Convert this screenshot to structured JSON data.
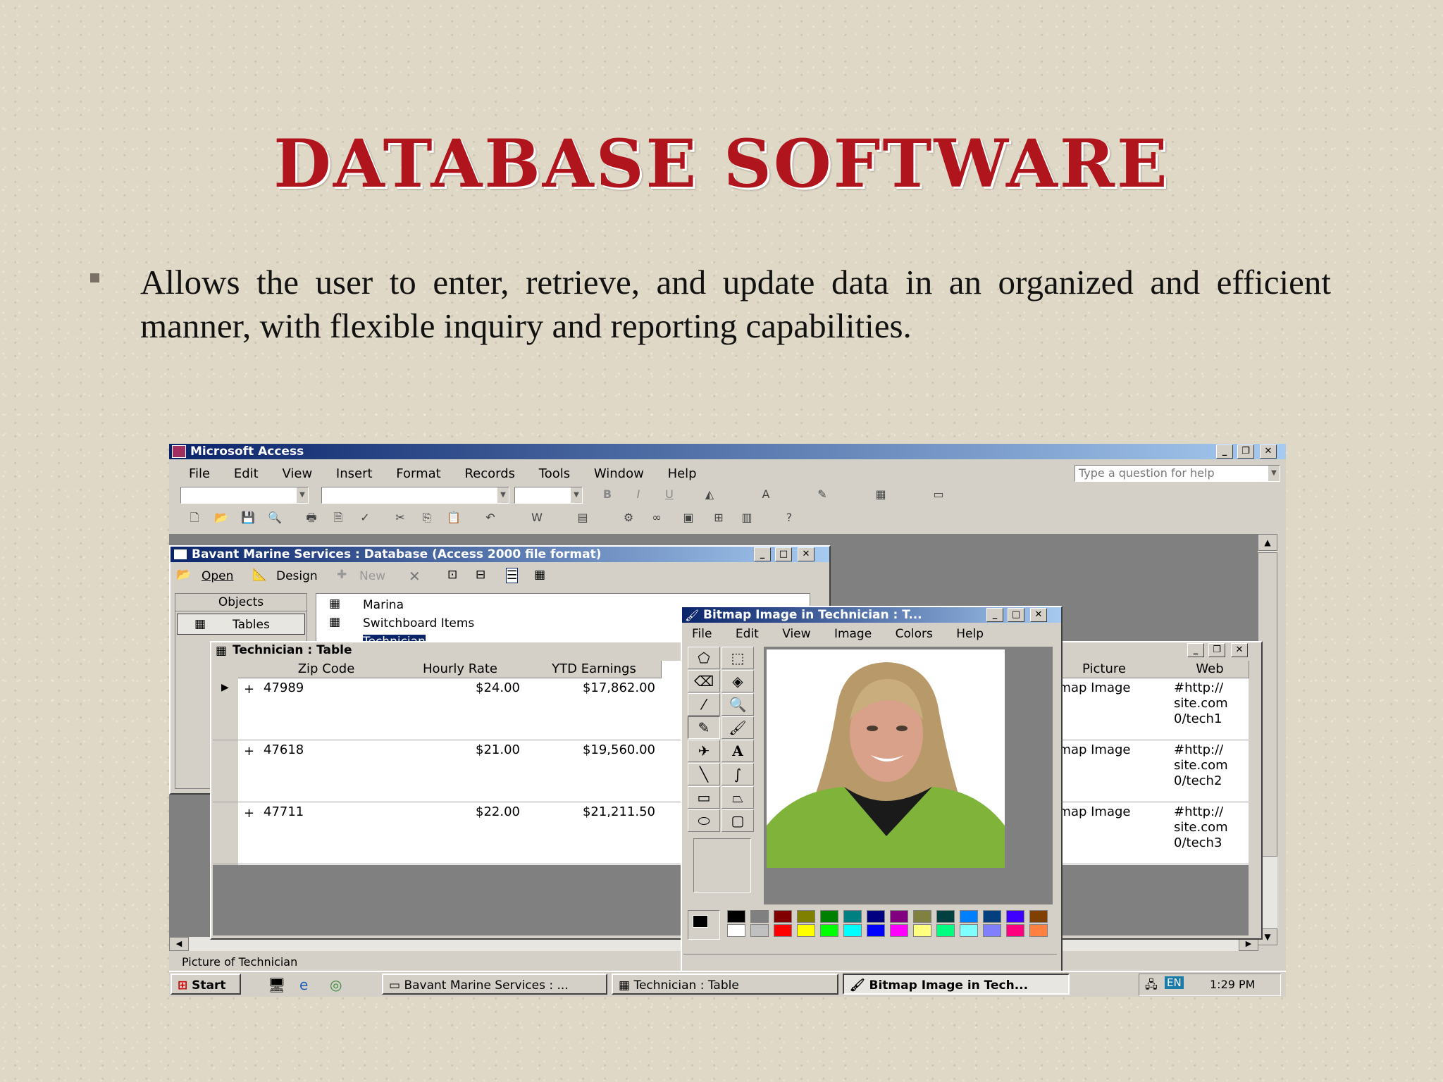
{
  "slide": {
    "title": "Database Software",
    "bullet": "Allows the user to enter, retrieve, and update data in an organized and efficient manner, with flexible inquiry and reporting capabilities."
  },
  "access": {
    "title": "Microsoft Access",
    "menu": [
      "File",
      "Edit",
      "View",
      "Insert",
      "Format",
      "Records",
      "Tools",
      "Window",
      "Help"
    ],
    "help_placeholder": "Type a question for help"
  },
  "db_window": {
    "title": "Bavant Marine Services : Database (Access 2000 file format)",
    "toolbar": {
      "open": "Open",
      "design": "Design",
      "new": "New"
    },
    "objects_label": "Objects",
    "tables_label": "Tables",
    "list": [
      "Marina",
      "Switchboard Items",
      "Technician"
    ]
  },
  "table_window": {
    "title": "Technician : Table",
    "columns": [
      "Zip Code",
      "Hourly Rate",
      "YTD Earnings"
    ],
    "right_columns": [
      "Picture",
      "Web"
    ],
    "rows": [
      {
        "zip": "47989",
        "rate": "$24.00",
        "ytd": "$17,862.00",
        "picture": "Bitmap Image",
        "web1": "#http://",
        "web2": "site.com",
        "web3": "0/tech1"
      },
      {
        "zip": "47618",
        "rate": "$21.00",
        "ytd": "$19,560.00",
        "picture": "Bitmap Image",
        "web1": "#http://",
        "web2": "site.com",
        "web3": "0/tech2"
      },
      {
        "zip": "47711",
        "rate": "$22.00",
        "ytd": "$21,211.50",
        "picture": "Bitmap Image",
        "web1": "#http://",
        "web2": "site.com",
        "web3": "0/tech3"
      }
    ]
  },
  "paint_window": {
    "title": "Bitmap Image in Technician : T...",
    "menu": [
      "File",
      "Edit",
      "View",
      "Image",
      "Colors",
      "Help"
    ],
    "palette_top": [
      "#000000",
      "#808080",
      "#800000",
      "#808000",
      "#008000",
      "#008080",
      "#000080",
      "#800080",
      "#808040",
      "#004040",
      "#0080ff",
      "#004080",
      "#4000ff",
      "#804000"
    ],
    "palette_bottom": [
      "#ffffff",
      "#c0c0c0",
      "#ff0000",
      "#ffff00",
      "#00ff00",
      "#00ffff",
      "#0000ff",
      "#ff00ff",
      "#ffff80",
      "#00ff80",
      "#80ffff",
      "#8080ff",
      "#ff0080",
      "#ff8040"
    ]
  },
  "status_bar": "Picture of Technician",
  "taskbar": {
    "start": "Start",
    "items": [
      "Bavant Marine Services : ...",
      "Technician : Table",
      "Bitmap Image in Tech..."
    ],
    "lang": "EN",
    "time": "1:29 PM"
  }
}
